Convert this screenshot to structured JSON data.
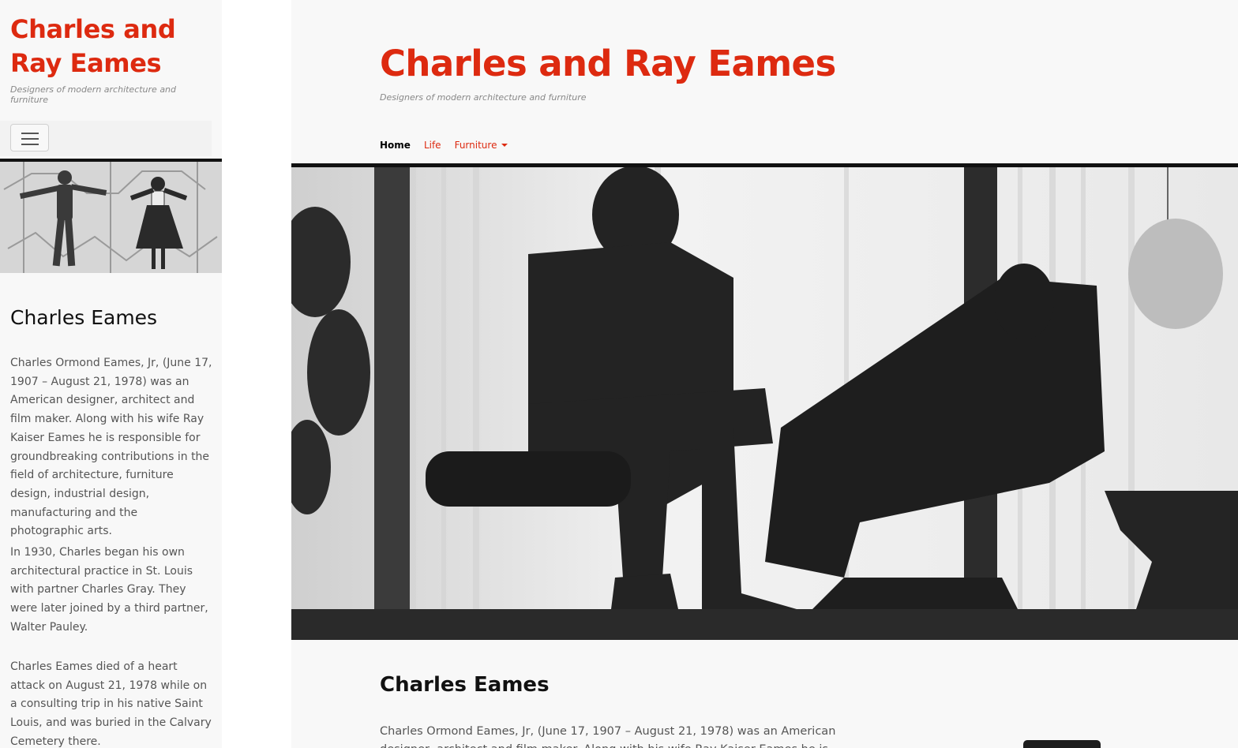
{
  "site": {
    "title": "Charles and Ray Eames",
    "tagline": "Designers of modern architecture and furniture"
  },
  "nav": {
    "items": [
      {
        "label": "Home",
        "active": true
      },
      {
        "label": "Life",
        "active": false
      },
      {
        "label": "Furniture",
        "active": false,
        "has_dropdown": true
      }
    ]
  },
  "icons": {
    "menu": "hamburger-menu-icon",
    "dropdown": "caret-down-icon"
  },
  "article": {
    "heading": "Charles Eames",
    "paragraphs": [
      "Charles Ormond Eames, Jr, (June 17, 1907 – August 21, 1978) was an American designer, architect and film maker. Along with his wife Ray Kaiser Eames he is responsible for groundbreaking contributions in the field of architecture, furniture design, industrial design, manufacturing and the photographic arts.",
      "In 1930, Charles began his own architectural practice in St. Louis with partner Charles Gray. They were later joined by a third partner, Walter Pauley.",
      "Charles Eames died of a heart attack on August 21, 1978 while on a consulting trip in his native Saint Louis, and was buried in the Calvary Cemetery there."
    ],
    "desktop_lead": "Charles Ormond Eames, Jr, (June 17, 1907 – August 21, 1978) was an American designer, architect and film maker. Along with his wife Ray Kaiser Eames he is responsible for"
  },
  "colors": {
    "brand": "#dd2a10",
    "text_muted": "#555555",
    "background": "#f8f8f8",
    "rule": "#111111"
  }
}
